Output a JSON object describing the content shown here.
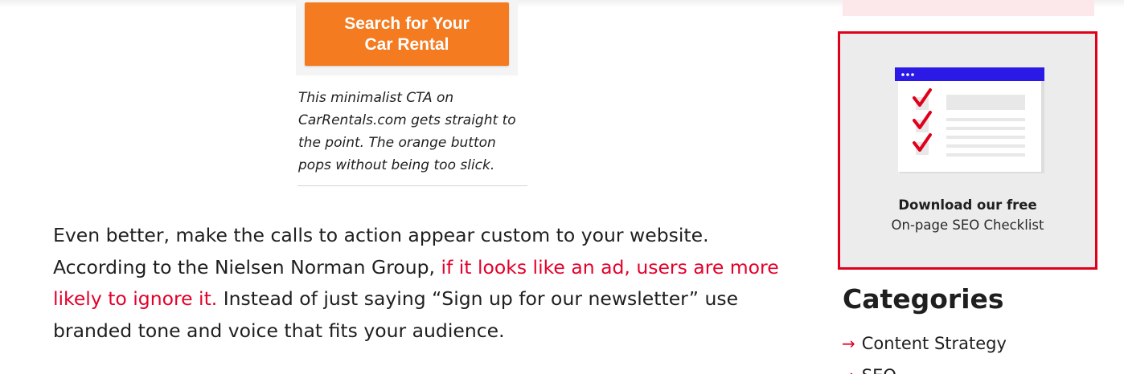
{
  "article": {
    "cta_button_label": "Search for Your Car Rental",
    "caption": "This minimalist CTA on CarRentals.com gets straight to the point. The orange button pops without being too slick.",
    "paragraph": {
      "text_before": "Even better, make the calls to action appear custom to your website. According to the Nielsen Norman Group, ",
      "link_text": "if it looks like an ad, users are more likely to ignore it.",
      "text_after": " Instead of just saying “Sign up for our newsletter” use branded tone and voice that fits your audience."
    }
  },
  "sidebar": {
    "promo": {
      "title": "Download our free",
      "subtitle": "On-page SEO Checklist",
      "icon": "checklist-illustration"
    },
    "categories_heading": "Categories",
    "categories": [
      {
        "label": "Content Strategy",
        "icon": "arrow-right-icon"
      },
      {
        "label": "SEO",
        "icon": "arrow-right-icon"
      }
    ]
  },
  "colors": {
    "cta_orange": "#f47b20",
    "link_red": "#e4002b",
    "promo_border": "#e0001b",
    "promo_bg": "#ececec",
    "browser_bar_blue": "#2b19e6"
  }
}
